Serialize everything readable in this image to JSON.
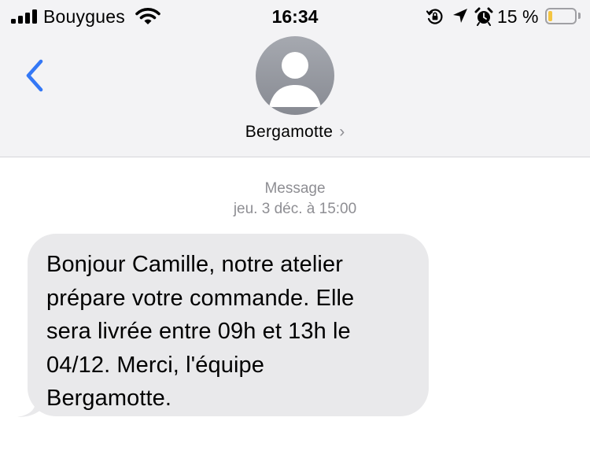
{
  "status_bar": {
    "carrier": "Bouygues",
    "time": "16:34",
    "battery_percent": "15 %",
    "battery_level": 0.15,
    "battery_color": "#f4c542",
    "signal_bars": 4,
    "icons": [
      "signal-icon",
      "wifi-icon",
      "orientation-lock-icon",
      "location-arrow-icon",
      "alarm-icon",
      "battery-icon"
    ]
  },
  "header": {
    "back_icon": "chevron-left-icon",
    "contact_name": "Bergamotte",
    "contact_chevron": "›",
    "avatar_icon": "person-silhouette-icon"
  },
  "conversation": {
    "service_label": "Message",
    "timestamp": "jeu. 3 déc. à 15:00",
    "messages": [
      {
        "direction": "incoming",
        "lines": [
          "Bonjour Camille, notre atelier",
          "prépare votre commande. Elle",
          "sera livrée entre 09h et 13h le",
          "04/12. Merci, l'équipe",
          "Bergamotte."
        ]
      }
    ]
  },
  "colors": {
    "accent": "#3478f6",
    "header_bg": "#f3f3f5",
    "bubble_bg": "#e9e9eb",
    "meta_text": "#8e8e93"
  }
}
